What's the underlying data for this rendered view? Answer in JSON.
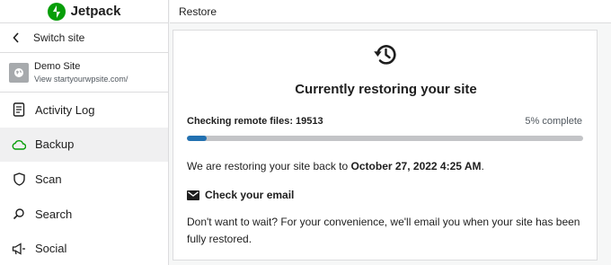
{
  "brand": {
    "name": "Jetpack",
    "color": "#069e08"
  },
  "sidebar": {
    "switch_label": "Switch site",
    "site": {
      "name": "Demo Site",
      "url": "View startyourwpsite.com/"
    },
    "items": [
      {
        "label": "Activity Log",
        "icon": "activity-log-icon"
      },
      {
        "label": "Backup",
        "icon": "cloud-icon",
        "active": true
      },
      {
        "label": "Scan",
        "icon": "shield-icon"
      },
      {
        "label": "Search",
        "icon": "search-icon"
      },
      {
        "label": "Social",
        "icon": "megaphone-icon"
      }
    ]
  },
  "header": {
    "title": "Restore"
  },
  "main": {
    "icon": "restore-history-icon",
    "title": "Currently restoring your site",
    "progress": {
      "label": "Checking remote files: 19513",
      "percent_text": "5% complete",
      "fraction": 0.05,
      "color": "#2271b1"
    },
    "message_prefix": "We are restoring your site back to ",
    "message_date": "October 27, 2022 4:25 AM",
    "message_suffix": ".",
    "email_heading": "Check your email",
    "email_body": "Don't want to wait? For your convenience, we'll email you when your site has been fully restored."
  }
}
